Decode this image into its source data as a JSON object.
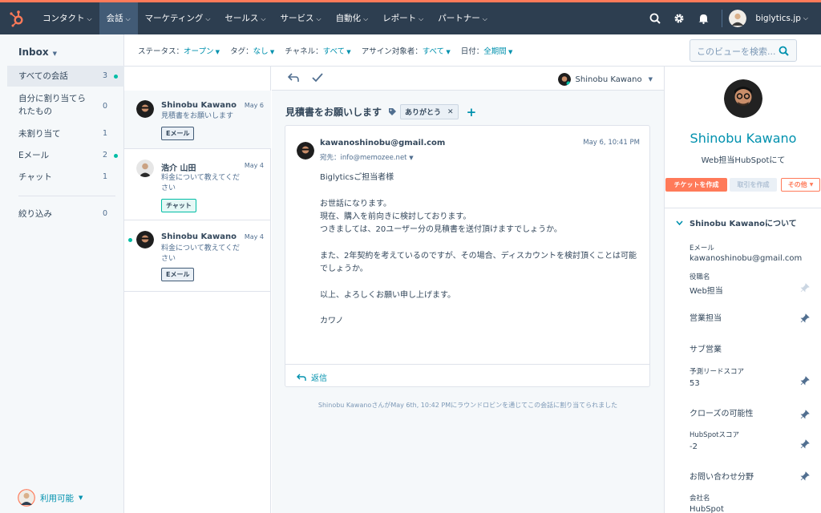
{
  "nav": {
    "items": [
      "コンタクト",
      "会話",
      "マーケティング",
      "セールス",
      "サービス",
      "自動化",
      "レポート",
      "パートナー"
    ],
    "user_name": "biglytics.jp"
  },
  "sidebar": {
    "title": "Inbox",
    "items": [
      {
        "label": "すべての会話",
        "count": "3"
      },
      {
        "label": "自分に割り当てられたもの",
        "count": "0"
      },
      {
        "label": "未割り当て",
        "count": "1"
      },
      {
        "label": "Eメール",
        "count": "2"
      },
      {
        "label": "チャット",
        "count": "1"
      },
      {
        "label": "絞り込み",
        "count": "0"
      }
    ],
    "status": "利用可能"
  },
  "filters": [
    {
      "label": "ステータス：",
      "value": "オープン"
    },
    {
      "label": "タグ：",
      "value": "なし"
    },
    {
      "label": "チャネル：",
      "value": "すべて"
    },
    {
      "label": "アサイン対象者：",
      "value": "すべて"
    },
    {
      "label": "日付：",
      "value": "全期間"
    }
  ],
  "search": {
    "placeholder": "このビューを検索..."
  },
  "conversations": [
    {
      "name": "Shinobu Kawano",
      "date": "May 6",
      "preview": "見積書をお願いします",
      "badge": "Eメール"
    },
    {
      "name": "浩介 山田",
      "date": "May 4",
      "preview": "料金について教えてください",
      "badge": "チャット"
    },
    {
      "name": "Shinobu Kawano",
      "date": "May 4",
      "preview": "料金について教えてください",
      "badge": "Eメール"
    }
  ],
  "thread": {
    "owner": "Shinobu Kawano",
    "subject": "見積書をお願いします",
    "tag": "ありがとう",
    "from": "kawanoshinobu@gmail.com",
    "to": "宛先：info@memozee.net",
    "date": "May 6, 10:41 PM",
    "body": [
      "Biglyticsご担当者様",
      "",
      "お世話になります。",
      "現在、購入を前向きに検討しております。",
      "つきましては、20ユーザー分の見積書を送付頂けますでしょうか。",
      "",
      "また、2年契約を考えているのですが、その場合、ディスカウントを検討頂くことは可能でしょうか。",
      "",
      "以上、よろしくお願い申し上げます。",
      "",
      "カワノ"
    ],
    "reply": "返信",
    "note": "Shinobu KawanoさんがMay 6th, 10:42 PMにラウンドロビンを通じてこの会話に割り当てられました"
  },
  "contact": {
    "name": "Shinobu Kawano",
    "role": "Web担当HubSpotにて",
    "buttons": {
      "ticket": "チケットを作成",
      "deal": "取引を作成",
      "more": "その他"
    },
    "section": "Shinobu Kawanoについて",
    "props": [
      {
        "label": "Eメール",
        "value": "kawanoshinobu@gmail.com"
      },
      {
        "label": "役職名",
        "value": "Web担当"
      },
      {
        "label": "営業担当",
        "value": ""
      },
      {
        "label": "サブ営業",
        "value": ""
      },
      {
        "label": "予測リードスコア",
        "value": "53"
      },
      {
        "label": "クローズの可能性",
        "value": ""
      },
      {
        "label": "HubSpotスコア",
        "value": "-2"
      },
      {
        "label": "お問い合わせ分野",
        "value": ""
      },
      {
        "label": "会社名",
        "value": "HubSpot"
      }
    ]
  },
  "colors": {
    "accent": "#0091ae",
    "brand": "#ff7a59",
    "nav": "#2d3e50",
    "online": "#00bda5"
  }
}
